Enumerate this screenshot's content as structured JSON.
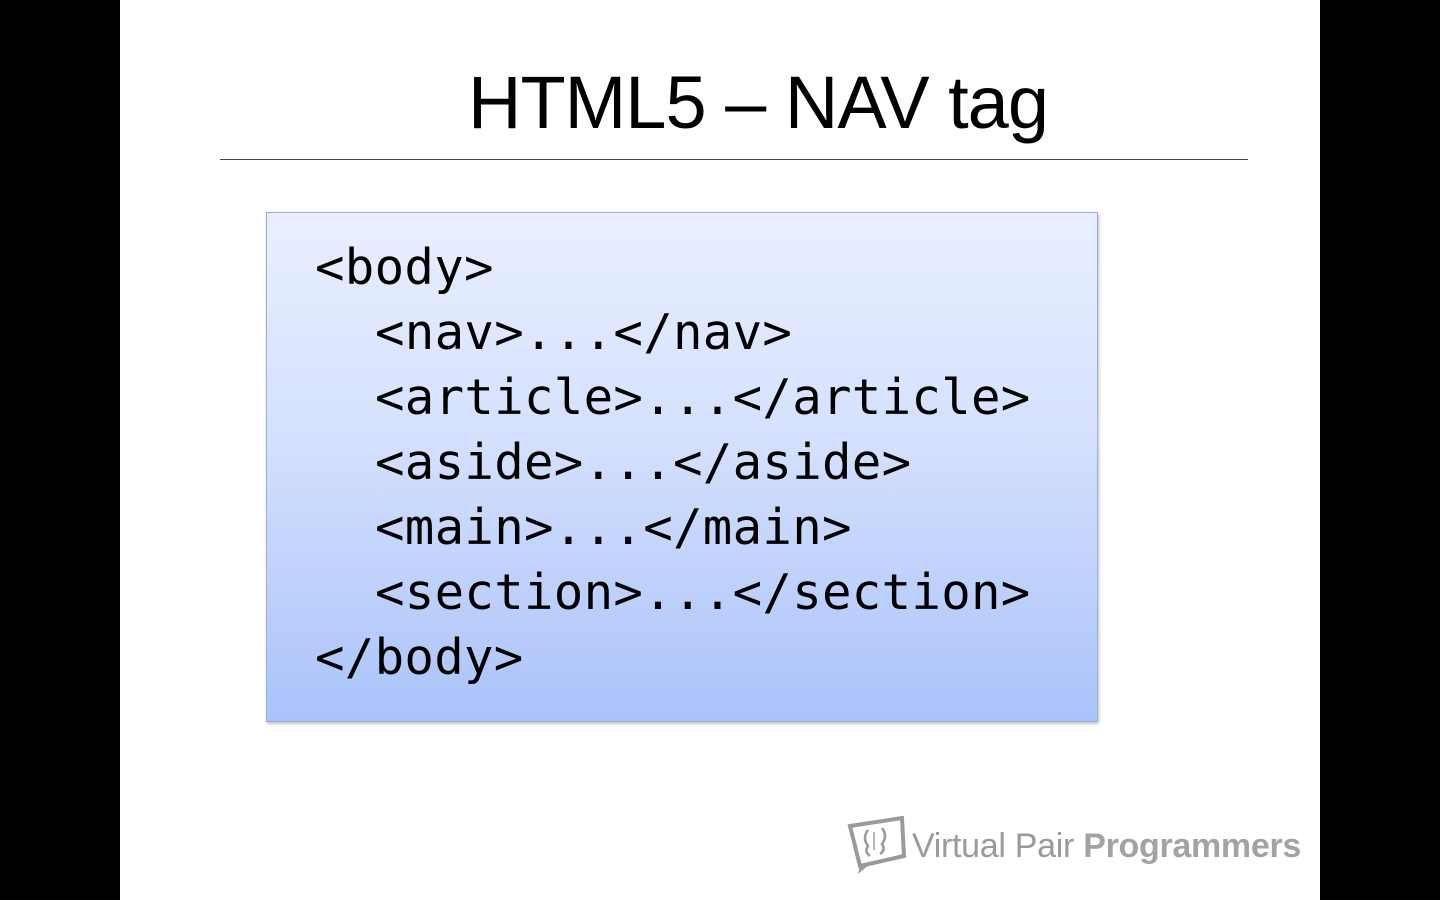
{
  "slide": {
    "title": "HTML5 – NAV tag",
    "code_lines": [
      {
        "text": "<body>",
        "indent": false
      },
      {
        "text": "<nav>...</nav>",
        "indent": true
      },
      {
        "text": "<article>...</article>",
        "indent": true
      },
      {
        "text": "<aside>...</aside>",
        "indent": true
      },
      {
        "text": "<main>...</main>",
        "indent": true
      },
      {
        "text": "<section>...</section>",
        "indent": true
      },
      {
        "text": "</body>",
        "indent": false
      }
    ]
  },
  "branding": {
    "logo_icon": "speech-bubbles-logo-icon",
    "name_light": "Virtual Pair ",
    "name_bold": "Programmers"
  },
  "colors": {
    "background": "#000000",
    "slide": "#ffffff",
    "code_box_top": "#e9efff",
    "code_box_bottom": "#aac3fa",
    "brand_gray": "#9a9a9a"
  }
}
